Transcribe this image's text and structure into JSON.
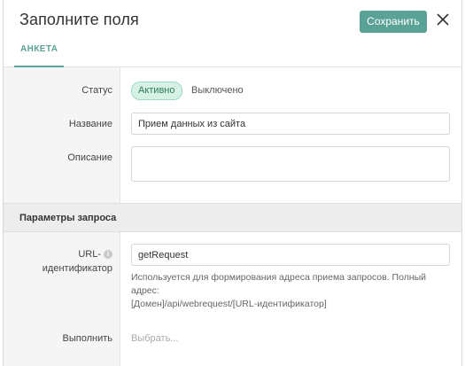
{
  "header": {
    "title": "Заполните поля",
    "save_label": "Сохранить"
  },
  "tabs": [
    {
      "label": "АНКЕТА",
      "active": true
    }
  ],
  "form": {
    "status_label": "Статус",
    "status_active": "Активно",
    "status_off": "Выключено",
    "name_label": "Название",
    "name_value": "Прием данных из сайта",
    "description_label": "Описание",
    "description_value": ""
  },
  "request_section": {
    "title": "Параметры запроса",
    "url_label_line1": "URL-",
    "url_label_line2": "идентификатор",
    "url_value": "getRequest",
    "hint_line1": "Используется для формирования адреса приема запросов. Полный",
    "hint_line2": "адрес:",
    "hint_line3": "[Домен]/api/webrequest/[URL-идентификатор]",
    "execute_label": "Выполнить",
    "execute_placeholder": "Выбрать..."
  },
  "colors": {
    "accent": "#5aa295",
    "active_badge_bg": "#d6f2e6"
  }
}
